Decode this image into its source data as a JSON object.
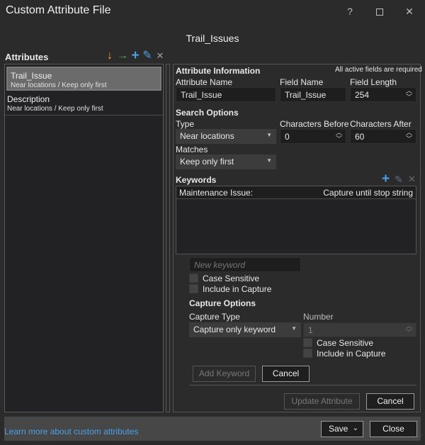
{
  "window": {
    "title": "Custom Attribute File",
    "controls": {
      "help": "?",
      "maximize": "☐",
      "close": "✕"
    }
  },
  "file_title": "Trail_Issues",
  "attributes_panel": {
    "label": "Attributes",
    "toolbar": [
      {
        "name": "move-down-icon",
        "glyph": "↓",
        "color": "#f0a030"
      },
      {
        "name": "move-right-icon",
        "glyph": "→",
        "color": "#4caf50"
      },
      {
        "name": "add-icon",
        "glyph": "+",
        "color": "#4aa0e8"
      },
      {
        "name": "edit-icon",
        "glyph": "✎",
        "color": "#4aa0e8"
      },
      {
        "name": "delete-icon",
        "glyph": "✕",
        "color": "#a0a0a0"
      }
    ],
    "items": [
      {
        "name": "Trail_Issue",
        "sub": "Near locations / Keep only first",
        "selected": true
      },
      {
        "name": "Description",
        "sub": "Near locations / Keep only first",
        "selected": false
      }
    ]
  },
  "attribute_info": {
    "heading": "Attribute Information",
    "required_note": "All active fields are required",
    "attribute_name_label": "Attribute Name",
    "attribute_name_value": "Trail_Issue",
    "field_name_label": "Field Name",
    "field_name_value": "Trail_Issue",
    "field_length_label": "Field Length",
    "field_length_value": "254"
  },
  "search_options": {
    "heading": "Search Options",
    "type_label": "Type",
    "type_value": "Near locations",
    "chars_before_label": "Characters Before",
    "chars_before_value": "0",
    "chars_after_label": "Characters After",
    "chars_after_value": "60",
    "matches_label": "Matches",
    "matches_value": "Keep only first"
  },
  "keywords": {
    "heading": "Keywords",
    "rows": [
      {
        "keyword": "Maintenance Issue:",
        "capture": "Capture until stop string"
      }
    ],
    "new_keyword_placeholder": "New keyword",
    "case_sensitive_label": "Case Sensitive",
    "include_in_capture_label": "Include in Capture"
  },
  "capture_options": {
    "heading": "Capture Options",
    "capture_type_label": "Capture Type",
    "capture_type_value": "Capture only keyword",
    "number_label": "Number",
    "number_value": "1",
    "case_sensitive_label": "Case Sensitive",
    "include_in_capture_label": "Include in Capture",
    "add_keyword_label": "Add Keyword",
    "cancel_label": "Cancel"
  },
  "attribute_actions": {
    "update_label": "Update Attribute",
    "cancel_label": "Cancel"
  },
  "footer": {
    "link_text": "Learn more about custom attributes",
    "save_label": "Save",
    "close_label": "Close"
  }
}
